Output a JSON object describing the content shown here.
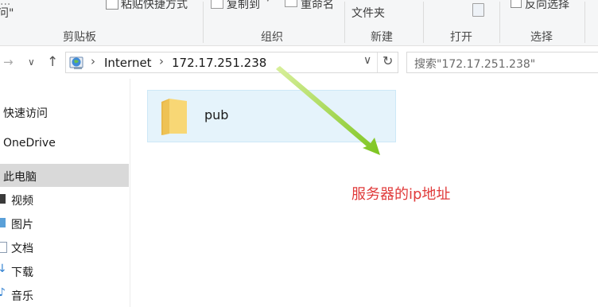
{
  "ribbon": {
    "clipboard_partial_top": "...",
    "clipboard_partial_quote": "问\"",
    "paste_shortcut": "粘贴快捷方式",
    "copy_to": "复制到",
    "rename": "重命名",
    "new_folder_line2": "文件夹",
    "reverse_select": "反向选择",
    "groups": {
      "clipboard": "剪贴板",
      "organize": "组织",
      "new": "新建",
      "open": "打开",
      "select": "选择"
    }
  },
  "address": {
    "crumbs": [
      "Internet",
      "172.17.251.238"
    ]
  },
  "search": {
    "placeholder": "搜索\"172.17.251.238\""
  },
  "navpane": {
    "items": [
      {
        "label": "快速访问"
      },
      {
        "label": "OneDrive"
      },
      {
        "label": "此电脑"
      },
      {
        "label": "视频"
      },
      {
        "label": "图片"
      },
      {
        "label": "文档"
      },
      {
        "label": "下载"
      },
      {
        "label": "音乐"
      }
    ]
  },
  "content": {
    "folders": [
      {
        "name": "pub"
      }
    ],
    "annotation": "服务器的ip地址"
  },
  "colors": {
    "annotation_text": "#e03a3a",
    "arrow": "#8cc63f",
    "selection": "#e5f3fb"
  }
}
